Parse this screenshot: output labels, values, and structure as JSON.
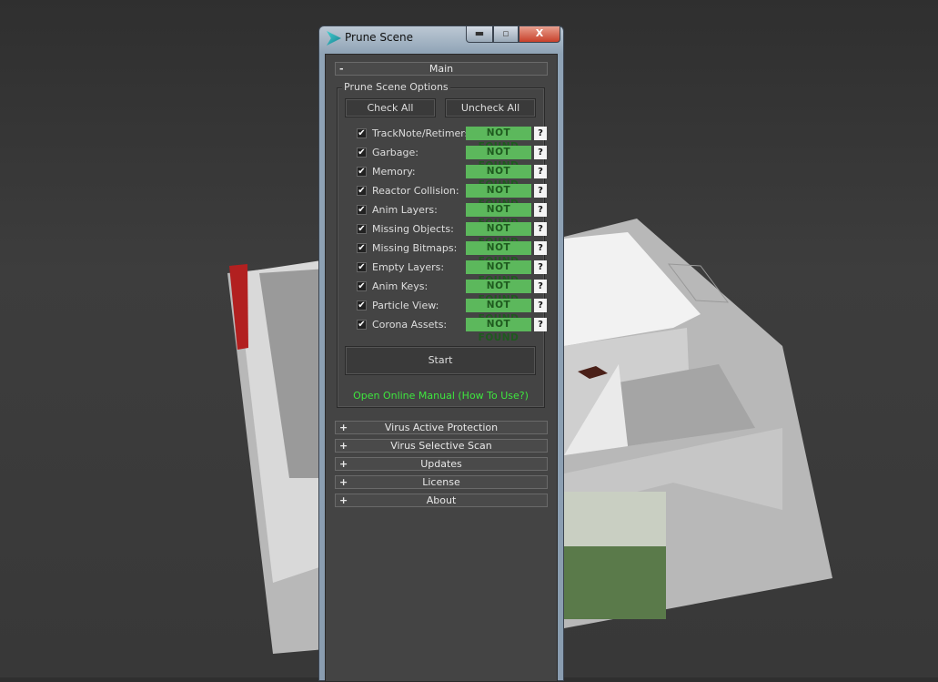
{
  "window": {
    "title": "Prune Scene",
    "minimize": "▬",
    "maximize": "▫",
    "close": "X"
  },
  "main_rollout": {
    "label": "Main",
    "sign": "-"
  },
  "group": {
    "label": "Prune Scene Options",
    "check_all": "Check All",
    "uncheck_all": "Uncheck All",
    "items": [
      {
        "label": "TrackNote/Retimers:",
        "checked": true,
        "status": "NOT FOUND",
        "help": "?"
      },
      {
        "label": "Garbage:",
        "checked": true,
        "status": "NOT FOUND",
        "help": "?"
      },
      {
        "label": "Memory:",
        "checked": true,
        "status": "NOT FOUND",
        "help": "?"
      },
      {
        "label": "Reactor Collision:",
        "checked": true,
        "status": "NOT FOUND",
        "help": "?"
      },
      {
        "label": "Anim Layers:",
        "checked": true,
        "status": "NOT FOUND",
        "help": "?"
      },
      {
        "label": "Missing Objects:",
        "checked": true,
        "status": "NOT FOUND",
        "help": "?"
      },
      {
        "label": "Missing Bitmaps:",
        "checked": true,
        "status": "NOT FOUND",
        "help": "?"
      },
      {
        "label": "Empty Layers:",
        "checked": true,
        "status": "NOT FOUND",
        "help": "?"
      },
      {
        "label": "Anim Keys:",
        "checked": true,
        "status": "NOT FOUND",
        "help": "?"
      },
      {
        "label": "Particle View:",
        "checked": true,
        "status": "NOT FOUND",
        "help": "?"
      },
      {
        "label": "Corona Assets:",
        "checked": true,
        "status": "NOT FOUND",
        "help": "?"
      }
    ],
    "start": "Start",
    "manual_link": "Open Online Manual (How To Use?)"
  },
  "rollouts": [
    {
      "label": "Virus Active Protection",
      "sign": "+"
    },
    {
      "label": "Virus Selective Scan",
      "sign": "+"
    },
    {
      "label": "Updates",
      "sign": "+"
    },
    {
      "label": "License",
      "sign": "+"
    },
    {
      "label": "About",
      "sign": "+"
    }
  ],
  "colors": {
    "status_found_bg": "#5cb85c",
    "link": "#3ee63e",
    "panel": "#444444"
  }
}
